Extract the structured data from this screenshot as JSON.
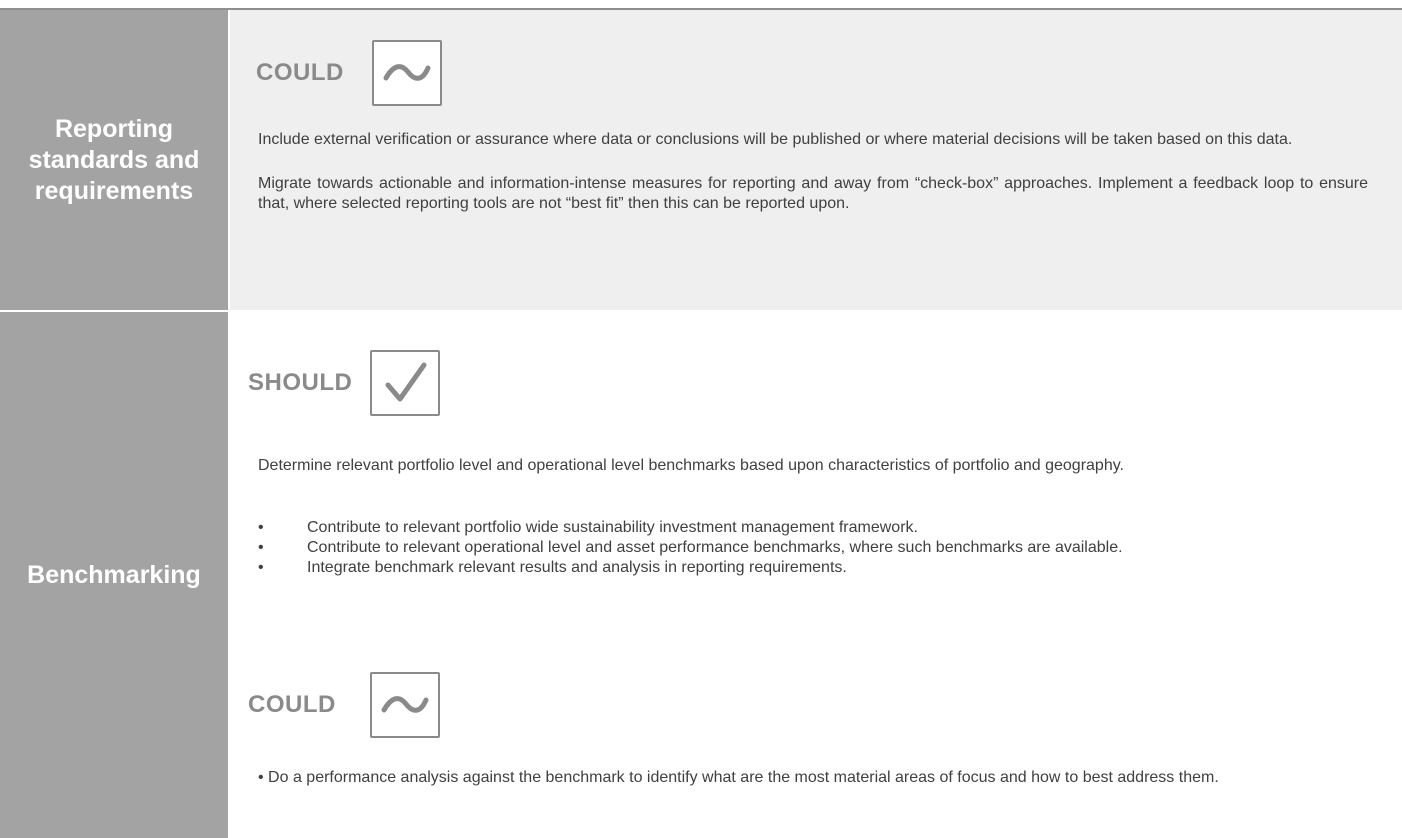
{
  "sections": [
    {
      "title": "Reporting standards and requirements",
      "levels": [
        {
          "label": "COULD",
          "icon": "tilde-icon",
          "paragraphs": [
            "Include external verification or assurance where data or conclusions will be published or where material decisions will be taken based on this data.",
            "Migrate towards actionable and information-intense measures for reporting and away from “check-box” approaches. Implement a feedback loop to ensure that, where selected reporting tools are not “best fit” then this can be reported upon."
          ]
        }
      ]
    },
    {
      "title": "Benchmarking",
      "levels": [
        {
          "label": "SHOULD",
          "icon": "checkmark-icon",
          "paragraphs": [
            "Determine relevant portfolio level and operational level benchmarks based upon characteristics of portfolio and geography."
          ],
          "bullets": [
            "Contribute to relevant portfolio wide sustainability investment management framework.",
            "Contribute to relevant operational level and asset performance benchmarks, where such benchmarks are available.",
            "Integrate benchmark relevant results and analysis in reporting requirements."
          ]
        },
        {
          "label": "COULD",
          "icon": "tilde-icon",
          "paragraphs": [
            "• Do a performance analysis against the benchmark to identify what are the most material areas of focus and how to best address them."
          ]
        }
      ]
    }
  ]
}
